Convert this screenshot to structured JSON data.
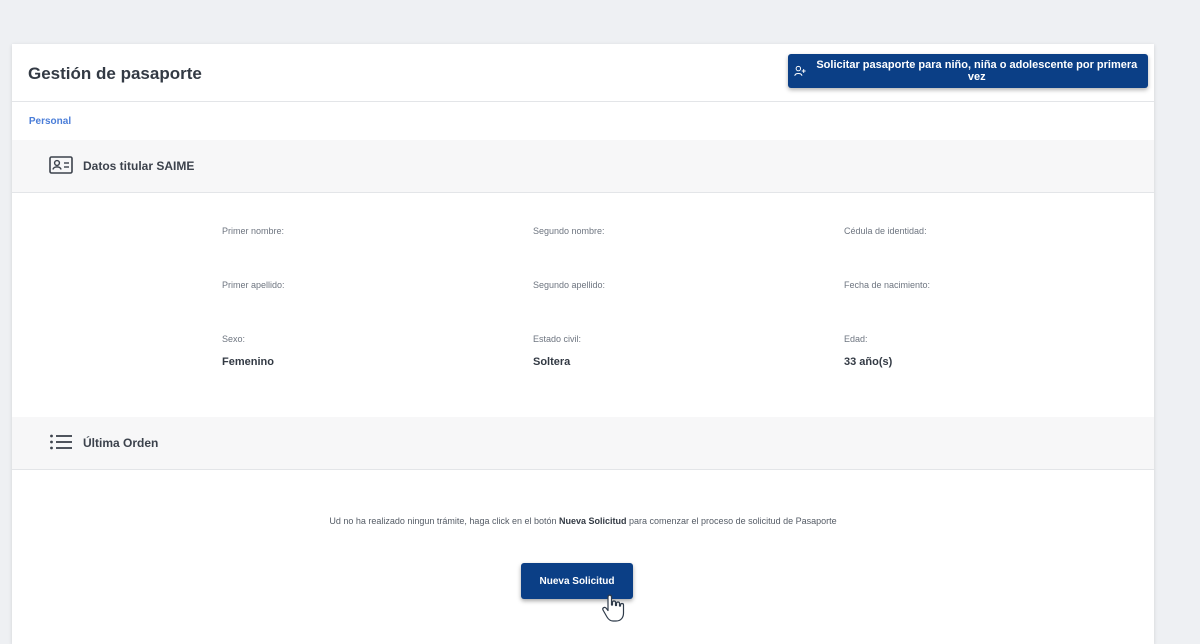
{
  "header": {
    "title": "Gestión de pasaporte",
    "action_button": "Solicitar pasaporte para niño, niña o adolescente por primera vez",
    "action_icon": "user-add-icon"
  },
  "tabs": [
    {
      "label": "Personal",
      "active": true
    }
  ],
  "titular": {
    "title": "Datos titular SAIME",
    "icon": "id-card-icon",
    "fields": {
      "primer_nombre": {
        "label": "Primer nombre:",
        "value": ""
      },
      "segundo_nombre": {
        "label": "Segundo nombre:",
        "value": ""
      },
      "cedula": {
        "label": "Cédula de identidad:",
        "value": ""
      },
      "primer_apellido": {
        "label": "Primer apellido:",
        "value": ""
      },
      "segundo_apellido": {
        "label": "Segundo apellido:",
        "value": ""
      },
      "fecha_nacimiento": {
        "label": "Fecha de nacimiento:",
        "value": ""
      },
      "sexo": {
        "label": "Sexo:",
        "value": "Femenino"
      },
      "estado_civil": {
        "label": "Estado civil:",
        "value": "Soltera"
      },
      "edad": {
        "label": "Edad:",
        "value": "33 año(s)"
      }
    }
  },
  "orden": {
    "title": "Última Orden",
    "icon": "list-icon",
    "message_before": "Ud no ha realizado ningun trámite, haga click en el botón ",
    "message_bold": "Nueva Solicitud",
    "message_after": " para comenzar el proceso de solicitud de Pasaporte",
    "button": "Nueva Solicitud"
  },
  "colors": {
    "primary": "#0b3f86",
    "tab_active": "#4a7dd8",
    "background": "#eef0f3"
  }
}
